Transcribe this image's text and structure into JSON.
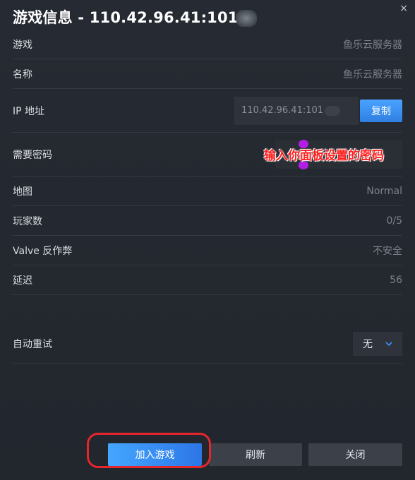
{
  "dialog": {
    "title": "游戏信息 - 110.42.96.41:101",
    "close_glyph": "×"
  },
  "rows": {
    "game": {
      "label": "游戏",
      "value": "鱼乐云服务器"
    },
    "name": {
      "label": "名称",
      "value": "鱼乐云服务器"
    },
    "ip": {
      "label": "IP 地址",
      "value": "110.42.96.41:101",
      "copy_label": "复制"
    },
    "password": {
      "label": "需要密码",
      "annotation": "输入你面板设置的密码"
    },
    "map": {
      "label": "地图",
      "value": "Normal"
    },
    "players": {
      "label": "玩家数",
      "value": "0/5"
    },
    "vac": {
      "label": "Valve 反作弊",
      "value": "不安全"
    },
    "latency": {
      "label": "延迟",
      "value": "56"
    },
    "auto_retry": {
      "label": "自动重试",
      "selected": "无"
    }
  },
  "buttons": {
    "join": "加入游戏",
    "refresh": "刷新",
    "close": "关闭"
  },
  "colors": {
    "accent": "#2f7fe0",
    "annotation_red": "#ff2020",
    "highlight_red": "#e5262c"
  }
}
